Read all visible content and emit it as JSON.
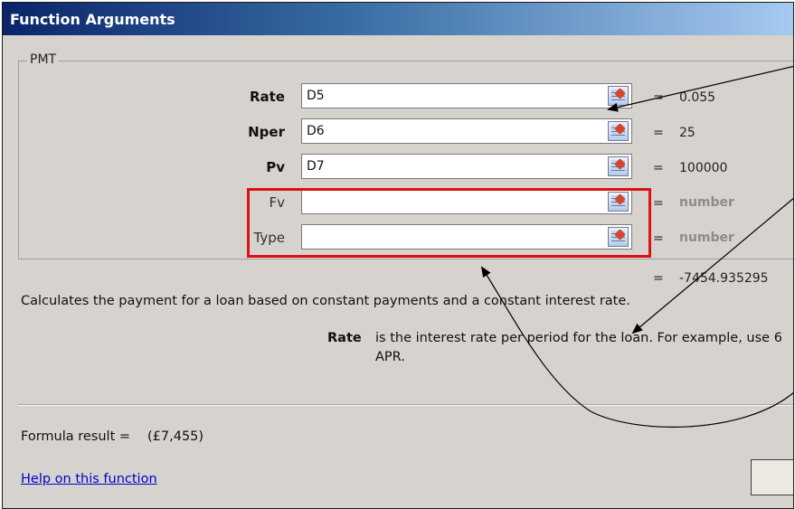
{
  "dialog": {
    "title": "Function Arguments"
  },
  "group": {
    "name": "PMT"
  },
  "args": [
    {
      "label": "Rate",
      "value": "D5",
      "result": "0.055",
      "required": true
    },
    {
      "label": "Nper",
      "value": "D6",
      "result": "25",
      "required": true
    },
    {
      "label": "Pv",
      "value": "D7",
      "result": "100000",
      "required": true
    },
    {
      "label": "Fv",
      "value": "",
      "result": "number",
      "required": false
    },
    {
      "label": "Type",
      "value": "",
      "result": "number",
      "required": false
    }
  ],
  "equals_sign": "=",
  "function_result": "-7454.935295",
  "description": "Calculates the payment for a loan based on constant payments and a constant interest rate.",
  "arg_help": {
    "name": "Rate",
    "text_line1": "is the interest rate per period for the loan. For example, use 6",
    "text_line2": "APR."
  },
  "formula_result": {
    "label": "Formula result =",
    "value": "(£7,455)"
  },
  "help_link": "Help on this function",
  "colors": {
    "highlight_box": "#e01010",
    "title_bar": "#0a246a",
    "link": "#0000cc"
  },
  "icons": [
    "collapse-dialog-icon"
  ]
}
